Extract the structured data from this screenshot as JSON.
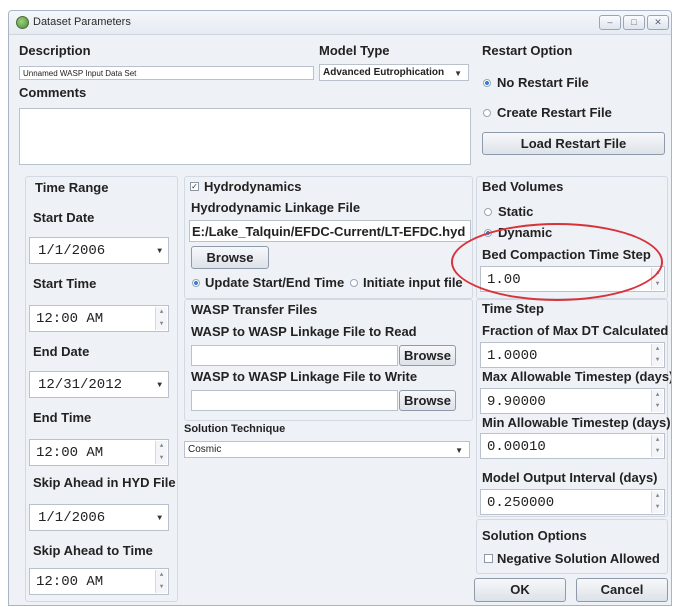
{
  "window": {
    "title": "Dataset Parameters",
    "controls": [
      "min",
      "max",
      "close"
    ]
  },
  "description": {
    "label": "Description",
    "value": "Unnamed WASP Input Data Set"
  },
  "comments": {
    "label": "Comments",
    "value": ""
  },
  "model_type": {
    "label": "Model Type",
    "value": "Advanced Eutrophication"
  },
  "restart": {
    "label": "Restart Option",
    "options": [
      "No Restart File",
      "Create Restart File"
    ],
    "selected": "No Restart File",
    "load_button": "Load Restart File"
  },
  "time_range": {
    "label": "Time Range",
    "start_date_label": "Start Date",
    "start_date": "1/1/2006",
    "start_time_label": "Start Time",
    "start_time": "12:00 AM",
    "end_date_label": "End Date",
    "end_date": "12/31/2012",
    "end_time_label": "End Time",
    "end_time": "12:00 AM",
    "skip_hyd_label": "Skip Ahead in HYD File",
    "skip_hyd": "1/1/2006",
    "skip_time_label": "Skip Ahead to Time",
    "skip_time": "12:00 AM"
  },
  "hydro": {
    "checkbox_label": "Hydrodynamics",
    "checked": true,
    "linkage_label": "Hydrodynamic Linkage File",
    "linkage_path": "E:/Lake_Talquin/EFDC-Current/LT-EFDC.hyd",
    "browse": "Browse",
    "update_label": "Update Start/End Time",
    "initiate_label": "Initiate input file",
    "selected": "Update Start/End Time"
  },
  "wasp_transfer": {
    "label": "WASP Transfer Files",
    "read_label": "WASP to WASP Linkage File to Read",
    "read_value": "",
    "write_label": "WASP to WASP Linkage File to Write",
    "write_value": "",
    "browse": "Browse"
  },
  "solution_technique": {
    "label": "Solution Technique",
    "value": "Cosmic"
  },
  "bed_volumes": {
    "label": "Bed Volumes",
    "options": [
      "Static",
      "Dynamic"
    ],
    "selected": "Dynamic",
    "compaction_label": "Bed Compaction Time Step",
    "compaction_value": "1.00"
  },
  "time_step": {
    "label": "Time Step",
    "fraction_label": "Fraction of Max DT Calculated",
    "fraction_value": "1.0000",
    "max_label": "Max Allowable Timestep (days)",
    "max_value": "9.90000",
    "min_label": "Min Allowable Timestep (days)",
    "min_value": "0.00010",
    "output_label": "Model Output Interval (days)",
    "output_value": "0.250000"
  },
  "solution_options": {
    "label": "Solution Options",
    "negative_label": "Negative Solution Allowed",
    "negative_checked": false
  },
  "buttons": {
    "ok": "OK",
    "cancel": "Cancel"
  },
  "annotation": {
    "color": "#d8333b"
  }
}
